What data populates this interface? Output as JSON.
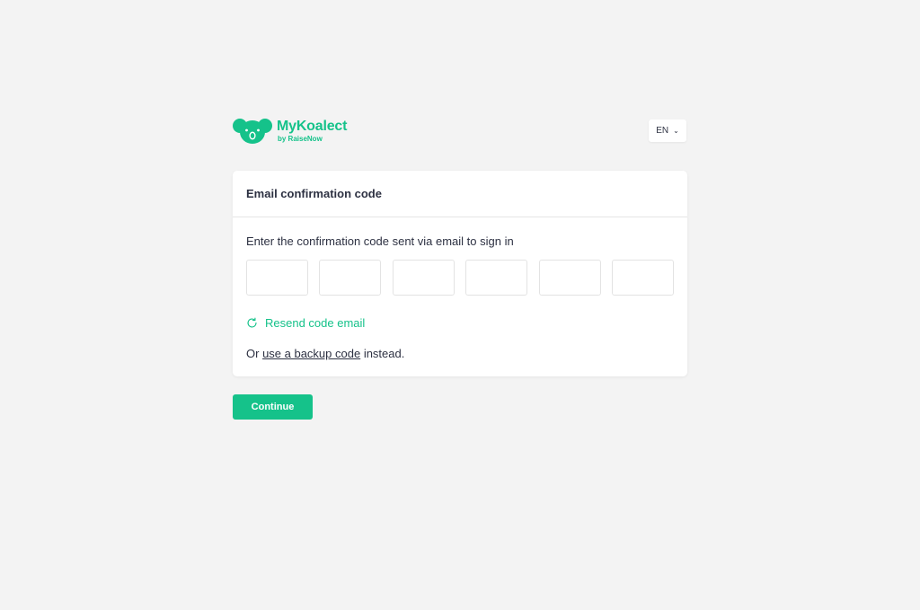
{
  "brand": {
    "name": "MyKoalect",
    "subtitle": "by RaiseNow",
    "color": "#15c28a",
    "logo_icon": "koala-icon"
  },
  "language": {
    "selected": "EN",
    "icon": "chevron-down-icon"
  },
  "card": {
    "title": "Email confirmation code",
    "instruction": "Enter the confirmation code sent via email to sign in",
    "code_fields": [
      "",
      "",
      "",
      "",
      "",
      ""
    ],
    "resend_label": "Resend code email",
    "resend_icon": "refresh-icon",
    "backup_prefix": "Or ",
    "backup_link": "use a backup code",
    "backup_suffix": " instead."
  },
  "actions": {
    "continue_label": "Continue"
  },
  "colors": {
    "background": "#f3f3f3",
    "accent": "#15c28a",
    "text": "#2d3142"
  }
}
